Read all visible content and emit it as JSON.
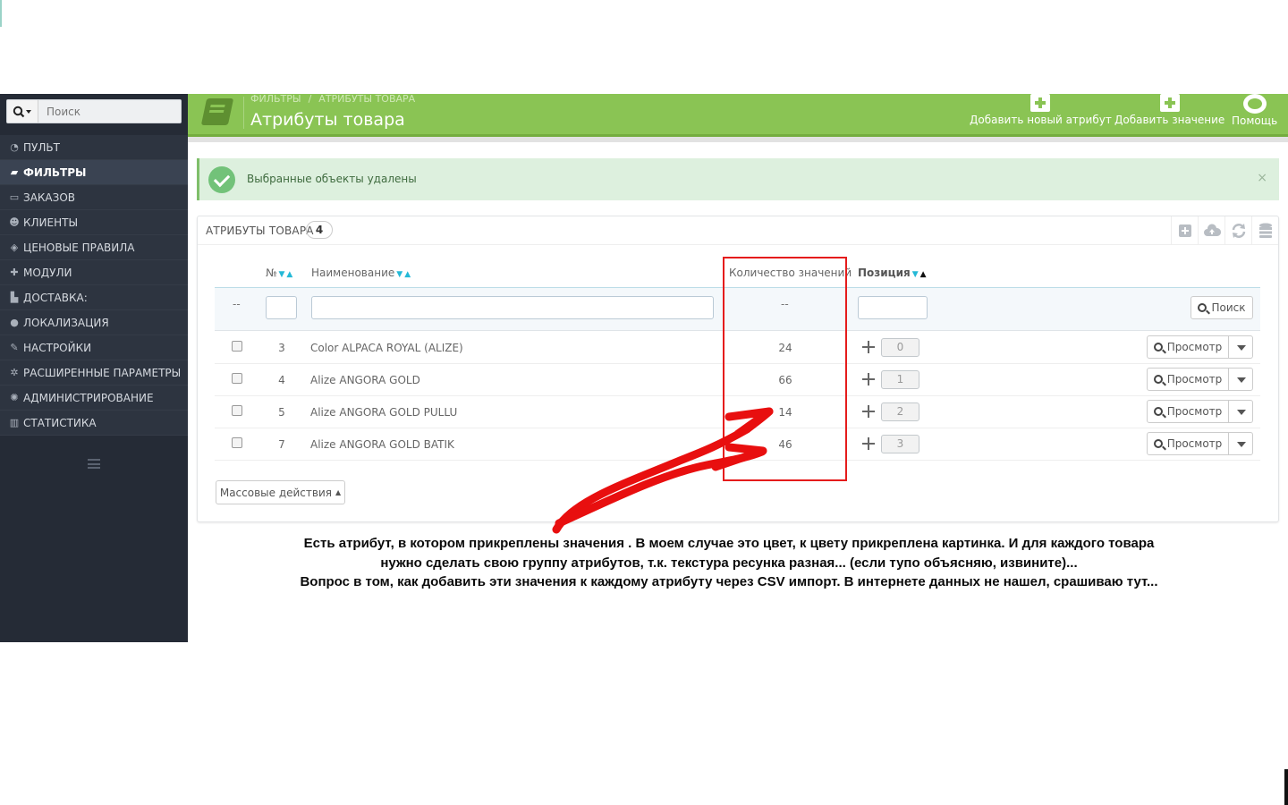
{
  "sidebar": {
    "search_placeholder": "Поиск",
    "items": [
      {
        "label": "ПУЛЬТ",
        "icon": "dashboard-icon",
        "active": false
      },
      {
        "label": "ФИЛЬТРЫ",
        "icon": "book-icon",
        "active": true
      },
      {
        "label": "ЗАКАЗОВ",
        "icon": "credit-card-icon",
        "active": false
      },
      {
        "label": "КЛИЕНТЫ",
        "icon": "users-icon",
        "active": false
      },
      {
        "label": "ЦЕНОВЫЕ ПРАВИЛА",
        "icon": "tags-icon",
        "active": false
      },
      {
        "label": "МОДУЛИ",
        "icon": "puzzle-icon",
        "active": false
      },
      {
        "label": "ДОСТАВКА:",
        "icon": "truck-icon",
        "active": false
      },
      {
        "label": "ЛОКАЛИЗАЦИЯ",
        "icon": "globe-icon",
        "active": false
      },
      {
        "label": "НАСТРОЙКИ",
        "icon": "wrench-icon",
        "active": false
      },
      {
        "label": "РАСШИРЕННЫЕ ПАРАМЕТРЫ",
        "icon": "cogs-icon",
        "active": false
      },
      {
        "label": "АДМИНИСТРИРОВАНИЕ",
        "icon": "gear-icon",
        "active": false
      },
      {
        "label": "СТАТИСТИКА",
        "icon": "bar-chart-icon",
        "active": false
      }
    ]
  },
  "header": {
    "breadcrumb": [
      "ФИЛЬТРЫ",
      "/",
      "АТРИБУТЫ ТОВАРА"
    ],
    "title": "Атрибуты товара",
    "buttons": {
      "add_attribute": "Добавить новый атрибут",
      "add_value": "Добавить значение",
      "help": "Помощь"
    },
    "accent": "#8ac454"
  },
  "alert": {
    "text": "Выбранные объекты удалены",
    "close": "×"
  },
  "panel": {
    "title": "АТРИБУТЫ ТОВАРА",
    "count": "4",
    "columns": {
      "id": "№",
      "name": "Наименование",
      "count": "Количество значений",
      "position": "Позиция"
    },
    "filter": {
      "id_dash": "--",
      "count_dash": "--",
      "search_button": "Поиск"
    },
    "rows": [
      {
        "id": "3",
        "name": "Color ALPACA ROYAL (ALIZE)",
        "count": "24",
        "position": "0",
        "view": "Просмотр"
      },
      {
        "id": "4",
        "name": "Alize ANGORA GOLD",
        "count": "66",
        "position": "1",
        "view": "Просмотр"
      },
      {
        "id": "5",
        "name": "Alize ANGORA GOLD PULLU",
        "count": "14",
        "position": "2",
        "view": "Просмотр"
      },
      {
        "id": "7",
        "name": "Alize ANGORA GOLD BATIK",
        "count": "46",
        "position": "3",
        "view": "Просмотр"
      }
    ],
    "bulk_actions": "Массовые действия"
  },
  "annotation": {
    "lines": [
      "Есть атрибут, в котором прикреплены значения . В моем случае это цвет, к цвету прикреплена картинка. И для каждого товара",
      "нужно сделать свою группу атрибутов, т.к. текстура ресунка разная... (если тупо объясняю, извините)...",
      "Вопрос в том, как добавить эти значения к каждому атрибуту через CSV импорт. В интернете данных не нашел, срашиваю тут..."
    ],
    "highlight_color": "#e51c1c"
  }
}
